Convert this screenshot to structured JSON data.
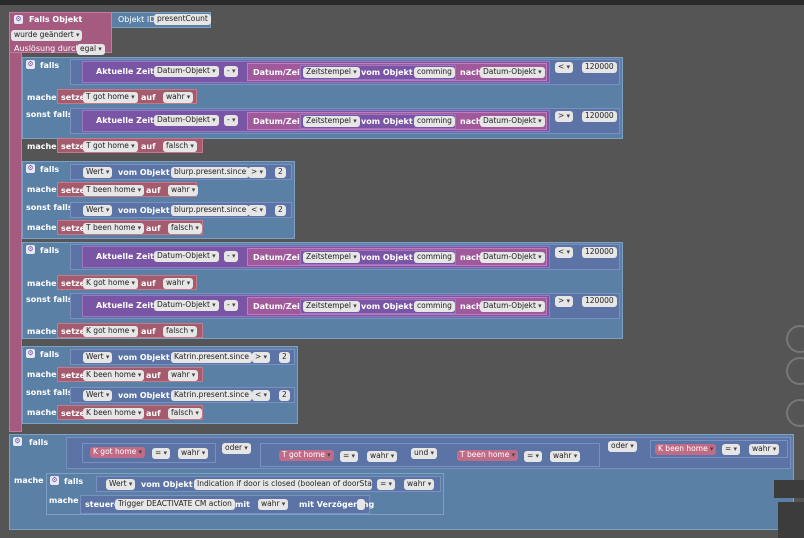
{
  "trigger": {
    "title": "Falls Objekt",
    "object_id_label": "Objekt ID",
    "object_id": "presentCount",
    "changed": "wurde geändert",
    "triggered_by": "Auslösung durch",
    "triggered_value": "egal"
  },
  "kw": {
    "falls": "falls",
    "mache": "mache",
    "sonst_falls": "sonst falls",
    "setze": "setze",
    "auf": "auf",
    "wert": "Wert",
    "vom_objekt_id": "vom Objekt ID",
    "aktuelle_zeit_als": "Aktuelle Zeit als",
    "datum_objekt": "Datum-Objekt",
    "minus": "-",
    "datum_zeit": "Datum/Zeit",
    "zeitstempel": "Zeitstempel",
    "commin": "comming",
    "nach": "nach",
    "lt": "<",
    "gt": ">",
    "oder": "oder",
    "und": "und",
    "eq": "=",
    "wahr": "wahr",
    "falsch": "falsch",
    "steuere": "steuere",
    "mit": "mit",
    "mit_verzoegerung": "mit Verzögerung"
  },
  "values": {
    "num120000": "120000",
    "num2": "2",
    "t_got_home": "T got home",
    "t_been_home": "T been home",
    "k_got_home": "K got home",
    "k_been_home": "K been home",
    "blurp": "blurp.present.since",
    "katrin": "Katrin.present.since",
    "door": "Indication if door is closed (boolean of doorSta...",
    "trigger_deact": "Trigger DEACTIVATE CM action"
  }
}
